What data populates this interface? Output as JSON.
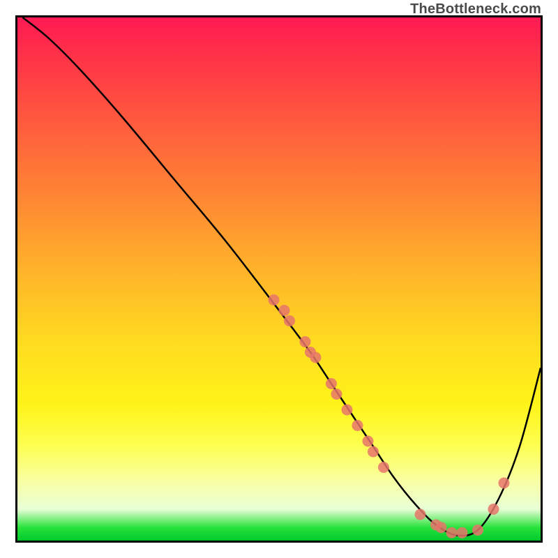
{
  "watermark": "TheBottleneck.com",
  "chart_data": {
    "type": "line",
    "title": "",
    "xlabel": "",
    "ylabel": "",
    "xlim": [
      0,
      100
    ],
    "ylim": [
      0,
      100
    ],
    "grid": false,
    "legend": false,
    "background_gradient": {
      "orientation": "vertical",
      "stops": [
        {
          "pos": 0.0,
          "color": "#ff1a53"
        },
        {
          "pos": 0.5,
          "color": "#ffdb20"
        },
        {
          "pos": 0.95,
          "color": "#e8ffd6"
        },
        {
          "pos": 1.0,
          "color": "#00c92e"
        }
      ]
    },
    "series": [
      {
        "name": "bottleneck_curve",
        "color": "#000000",
        "x": [
          1,
          6,
          12,
          20,
          30,
          40,
          50,
          56,
          60,
          64,
          68,
          72,
          76,
          80,
          84,
          88,
          92,
          96,
          100
        ],
        "y": [
          100,
          96,
          90,
          81,
          69,
          57,
          44,
          36,
          30,
          24,
          18,
          12,
          7,
          3,
          1,
          2,
          8,
          18,
          33
        ]
      }
    ],
    "markers": {
      "name": "highlight_points",
      "color": "#e6766b",
      "radius": 8,
      "points": [
        {
          "x": 49,
          "y": 46
        },
        {
          "x": 51,
          "y": 44
        },
        {
          "x": 52,
          "y": 42
        },
        {
          "x": 55,
          "y": 38
        },
        {
          "x": 56,
          "y": 36
        },
        {
          "x": 57,
          "y": 35
        },
        {
          "x": 60,
          "y": 30
        },
        {
          "x": 61,
          "y": 28
        },
        {
          "x": 63,
          "y": 25
        },
        {
          "x": 65,
          "y": 22
        },
        {
          "x": 67,
          "y": 19
        },
        {
          "x": 68,
          "y": 17
        },
        {
          "x": 70,
          "y": 14
        },
        {
          "x": 77,
          "y": 5
        },
        {
          "x": 80,
          "y": 3
        },
        {
          "x": 81,
          "y": 2.5
        },
        {
          "x": 83,
          "y": 1.5
        },
        {
          "x": 85,
          "y": 1.5
        },
        {
          "x": 88,
          "y": 2
        },
        {
          "x": 91,
          "y": 6
        },
        {
          "x": 93,
          "y": 11
        }
      ]
    }
  }
}
